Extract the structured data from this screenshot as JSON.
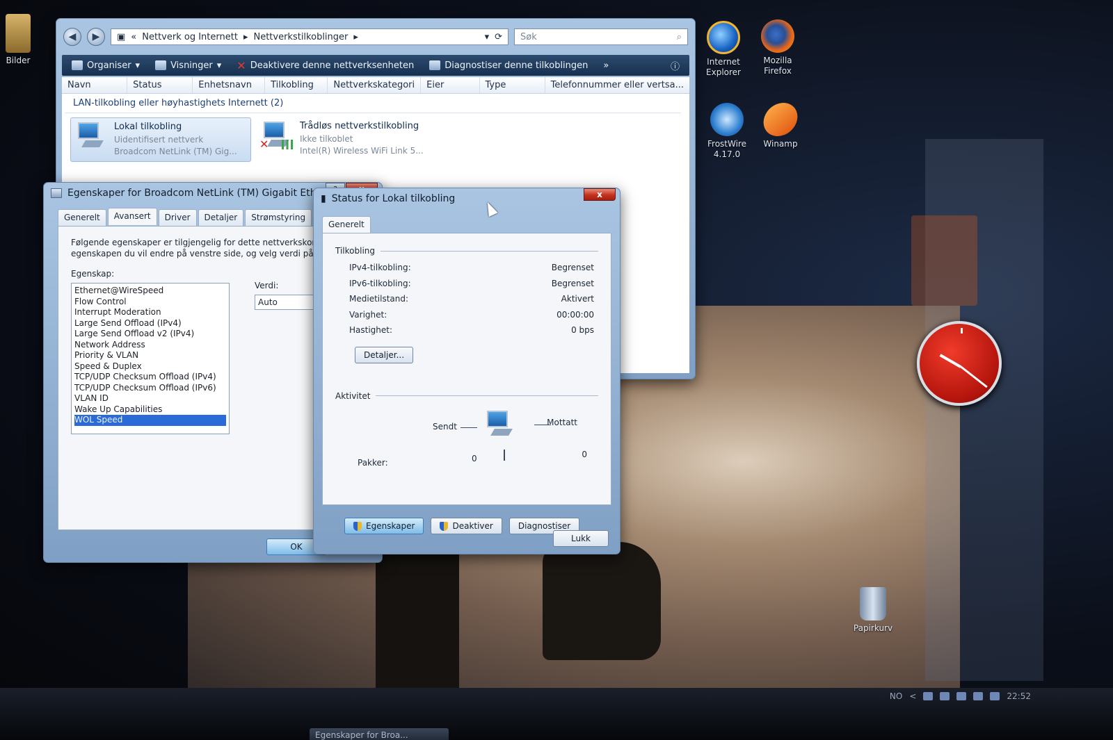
{
  "desktop": {
    "icons": [
      {
        "label": "Bilder"
      },
      {
        "label1": "Internet",
        "label2": "Explorer"
      },
      {
        "label1": "Mozilla",
        "label2": "Firefox"
      },
      {
        "label1": "FrostWire",
        "label2": "4.17.0"
      },
      {
        "label1": "Winamp"
      },
      {
        "label1": "Papirkurv"
      }
    ]
  },
  "explorer": {
    "breadcrumb": {
      "prefix": "«",
      "segment1": "Nettverk og Internett",
      "segment2": "Nettverkstilkoblinger"
    },
    "search_placeholder": "Søk",
    "toolbar": {
      "organize": "Organiser",
      "views": "Visninger",
      "disable": "Deaktivere denne nettverksenheten",
      "diagnose": "Diagnostiser denne tilkoblingen",
      "more": "»"
    },
    "columns": [
      "Navn",
      "Status",
      "Enhetsnavn",
      "Tilkobling",
      "Nettverkskategori",
      "Eier",
      "Type",
      "Telefonnummer eller vertsa..."
    ],
    "group_title": "LAN-tilkobling eller høyhastighets Internett (2)",
    "connections": [
      {
        "name": "Lokal tilkobling",
        "status": "Uidentifisert nettverk",
        "device": "Broadcom NetLink (TM) Gig..."
      },
      {
        "name": "Trådløs nettverkstilkobling",
        "status": "Ikke tilkoblet",
        "device": "Intel(R) Wireless WiFi Link 5..."
      }
    ]
  },
  "props": {
    "title": "Egenskaper for Broadcom NetLink (TM) Gigabit Ethernet",
    "help": "?",
    "close": "x",
    "tabs": [
      "Generelt",
      "Avansert",
      "Driver",
      "Detaljer",
      "Strømstyring"
    ],
    "description": "Følgende egenskaper er tilgjengelig for dette nettverkskortet. K egenskapen du vil endre på venstre side, og velg verdi på høy side.",
    "property_label": "Egenskap:",
    "value_label": "Verdi:",
    "value": "Auto",
    "properties": [
      "Ethernet@WireSpeed",
      "Flow Control",
      "Interrupt Moderation",
      "Large Send Offload (IPv4)",
      "Large Send Offload v2 (IPv4)",
      "Network Address",
      "Priority & VLAN",
      "Speed & Duplex",
      "TCP/UDP Checksum Offload (IPv4)",
      "TCP/UDP Checksum Offload (IPv6)",
      "VLAN ID",
      "Wake Up Capabilities",
      "WOL Speed"
    ],
    "selected_index": 12,
    "ok": "OK"
  },
  "status": {
    "title": "Status for Lokal tilkobling",
    "close": "x",
    "tab": "Generelt",
    "connection_section": "Tilkobling",
    "rows": [
      {
        "k": "IPv4-tilkobling:",
        "v": "Begrenset"
      },
      {
        "k": "IPv6-tilkobling:",
        "v": "Begrenset"
      },
      {
        "k": "Medietilstand:",
        "v": "Aktivert"
      },
      {
        "k": "Varighet:",
        "v": "00:00:00"
      },
      {
        "k": "Hastighet:",
        "v": "0 bps"
      }
    ],
    "details_button": "Detaljer...",
    "activity_section": "Aktivitet",
    "sent_label": "Sendt",
    "received_label": "Mottatt",
    "packets_label": "Pakker:",
    "packets_sent": "0",
    "packets_received": "0",
    "properties_button": "Egenskaper",
    "disable_button": "Deaktiver",
    "diagnose_button": "Diagnostiser",
    "close_button": "Lukk"
  },
  "taskbar": {
    "language": "NO",
    "chevron": "<",
    "time": "22:52",
    "task_label": "Egenskaper for Broa..."
  }
}
